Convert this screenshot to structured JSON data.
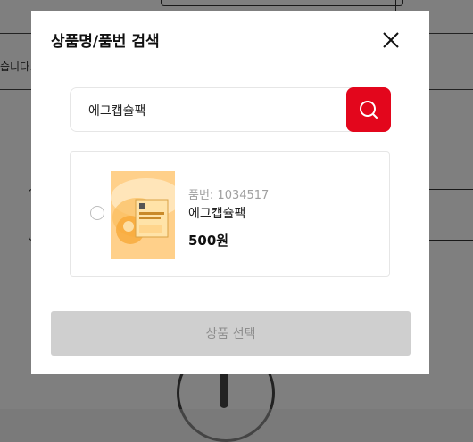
{
  "modal": {
    "title": "상품명/품번 검색",
    "close_icon": "close-icon"
  },
  "search": {
    "value": "에그캡슐팩",
    "icon": "search-icon",
    "accent_color": "#e3061c"
  },
  "results": [
    {
      "code_label": "품번: 1034517",
      "name": "에그캡슐팩",
      "price": "500원",
      "selected": false,
      "image_icon": "product-thumbnail"
    }
  ],
  "footer": {
    "select_label": "상품 선택",
    "disabled": true
  },
  "background": {
    "text": "습니다."
  }
}
